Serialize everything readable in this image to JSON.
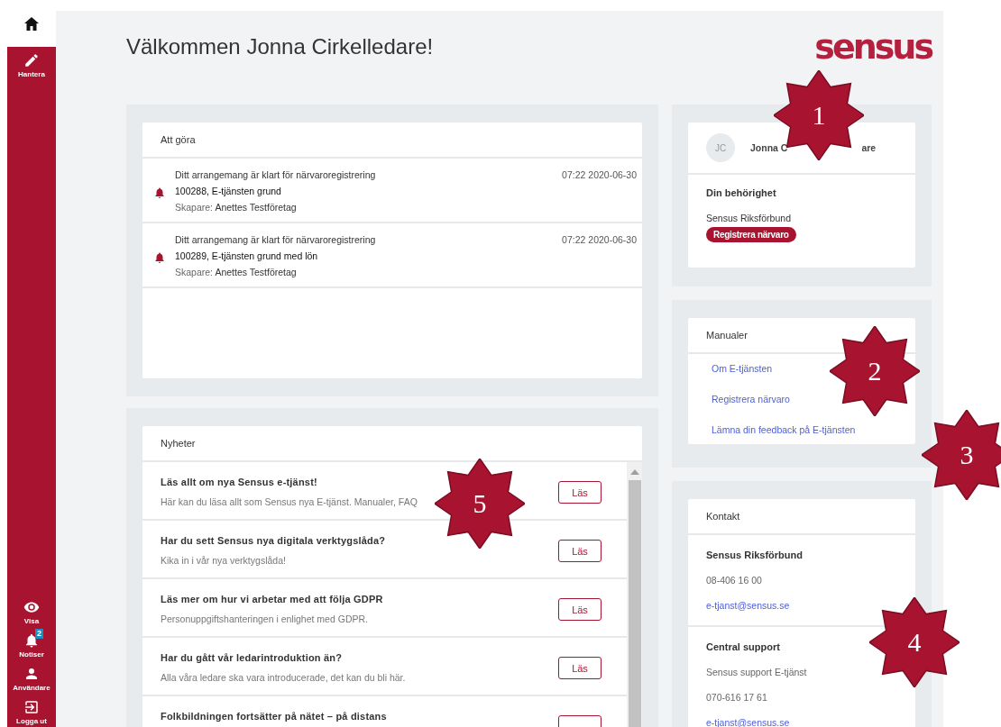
{
  "sidebar": {
    "top": {
      "kind": "home"
    },
    "top_items": [
      {
        "kind": "pencil",
        "label": "Hantera"
      }
    ],
    "bottom_items": [
      {
        "kind": "eye",
        "label": "Visa"
      },
      {
        "kind": "bell",
        "label": "Notiser",
        "badge": "2"
      },
      {
        "kind": "person",
        "label": "Användare"
      },
      {
        "kind": "logout",
        "label": "Logga ut"
      }
    ]
  },
  "title": "Välkommen Jonna Cirkelledare!",
  "logo": "sensus",
  "todo": {
    "title": "Att göra",
    "items": [
      {
        "line1": "Ditt arrangemang är klart för närvaroregistrering",
        "line2": "100288, E-tjänsten grund",
        "creator_label": "Skapare:",
        "creator": "Anettes Testföretag",
        "time": "07:22 2020-06-30"
      },
      {
        "line1": "Ditt arrangemang är klart för närvaroregistrering",
        "line2": "100289, E-tjänsten grund med lön",
        "creator_label": "Skapare:",
        "creator": "Anettes Testföretag",
        "time": "07:22 2020-06-30"
      }
    ]
  },
  "news": {
    "title": "Nyheter",
    "items": [
      {
        "title": "Läs allt om nya Sensus e-tjänst!",
        "text": "Här kan du läsa allt som Sensus nya E-tjänst. Manualer, FAQ",
        "button": "Läs"
      },
      {
        "title": "Har du sett Sensus nya digitala verktygslåda?",
        "text": "Kika in i vår nya verktygslåda!",
        "button": "Läs"
      },
      {
        "title": "Läs mer om hur vi arbetar med att följa GDPR",
        "text": "Personuppgiftshanteringen i enlighet med GDPR.",
        "button": "Läs"
      },
      {
        "title": "Har du gått vår ledarintroduktion än?",
        "text": "Alla våra ledare ska vara introducerade, det kan du bli här.",
        "button": "Läs"
      },
      {
        "title": "Folkbildningen fortsätter på nätet – på distans"
      }
    ]
  },
  "profile": {
    "initials": "JC",
    "name_visible_parts": [
      "Jonna C",
      "are"
    ],
    "permission_title": "Din behörighet",
    "organisation": "Sensus Riksförbund",
    "role": "Registrera närvaro"
  },
  "manuals": {
    "title": "Manualer",
    "links": [
      "Om E-tjänsten",
      "Registrera närvaro",
      "Lämna din feedback på E-tjänsten"
    ]
  },
  "contact": {
    "title": "Kontakt",
    "groups": [
      {
        "title": "Sensus Riksförbund",
        "lines": [
          {
            "kind": "text",
            "text": "08-406 16 00"
          },
          {
            "kind": "link",
            "text": "e-tjanst@sensus.se"
          }
        ]
      },
      {
        "title": "Central support",
        "lines": [
          {
            "kind": "text",
            "text": "Sensus support E-tjänst"
          },
          {
            "kind": "text",
            "text": "070-616 17 61"
          },
          {
            "kind": "link",
            "text": "e-tjanst@sensus.se"
          }
        ]
      }
    ]
  },
  "callouts": [
    "1",
    "2",
    "3",
    "4",
    "5"
  ]
}
